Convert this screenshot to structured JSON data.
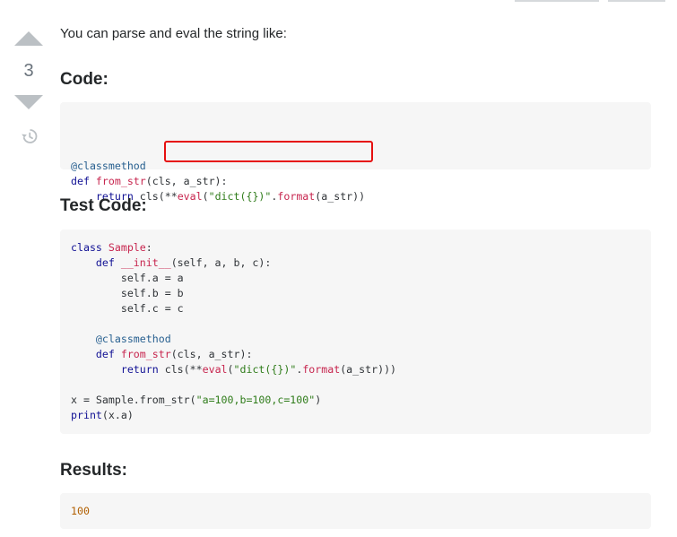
{
  "answer": {
    "vote_count": "3",
    "intro_text": "You can parse and eval the string like:",
    "heading_code": "Code:",
    "heading_test": "Test Code:",
    "heading_results": "Results:",
    "code_block_1": [
      [
        [
          "@classmethod",
          "dec"
        ]
      ],
      [
        [
          "def ",
          "kw"
        ],
        [
          "from_str",
          "fn"
        ],
        [
          "(cls, a_str):",
          ""
        ]
      ],
      [
        [
          "    return cls(",
          "kw0"
        ],
        [
          "**",
          ""
        ],
        [
          "eval",
          "fn"
        ],
        [
          "(",
          ""
        ],
        [
          "\"dict({})\"",
          "str"
        ],
        [
          ".",
          ""
        ],
        [
          "format",
          "fn"
        ],
        [
          "(a_str))",
          ""
        ]
      ]
    ],
    "code_block_2": [
      [
        [
          "class ",
          "kw"
        ],
        [
          "Sample",
          "fn"
        ],
        [
          ":",
          ""
        ]
      ],
      [
        [
          "    ",
          ""
        ],
        [
          "def ",
          "kw"
        ],
        [
          "__init__",
          "fn"
        ],
        [
          "(self, a, b, c):",
          ""
        ]
      ],
      [
        [
          "        self.a = a",
          ""
        ]
      ],
      [
        [
          "        self.b = b",
          ""
        ]
      ],
      [
        [
          "        self.c = c",
          ""
        ]
      ],
      [
        [
          "",
          ""
        ]
      ],
      [
        [
          "    ",
          ""
        ],
        [
          "@classmethod",
          "dec"
        ]
      ],
      [
        [
          "    ",
          ""
        ],
        [
          "def ",
          "kw"
        ],
        [
          "from_str",
          "fn"
        ],
        [
          "(cls, a_str):",
          ""
        ]
      ],
      [
        [
          "        ",
          ""
        ],
        [
          "return ",
          "kw"
        ],
        [
          "cls(**",
          ""
        ],
        [
          "eval",
          "fn"
        ],
        [
          "(",
          ""
        ],
        [
          "\"dict({})\"",
          "str"
        ],
        [
          ".",
          ""
        ],
        [
          "format",
          "fn"
        ],
        [
          "(a_str)))",
          ""
        ]
      ],
      [
        [
          "",
          ""
        ]
      ],
      [
        [
          "x = Sample.from_str(",
          ""
        ],
        [
          "\"a=100,b=100,c=100\"",
          "str"
        ],
        [
          ")",
          ""
        ]
      ],
      [
        [
          "print",
          "kw"
        ],
        [
          "(x.a)",
          ""
        ]
      ]
    ],
    "code_block_3": [
      [
        [
          "100",
          "num"
        ]
      ]
    ],
    "icons": {
      "upvote": "upvote-arrow-icon",
      "downvote": "downvote-arrow-icon",
      "history": "history-icon"
    },
    "colors": {
      "highlight_box": "#e61010",
      "code_background": "#f6f6f6"
    }
  }
}
